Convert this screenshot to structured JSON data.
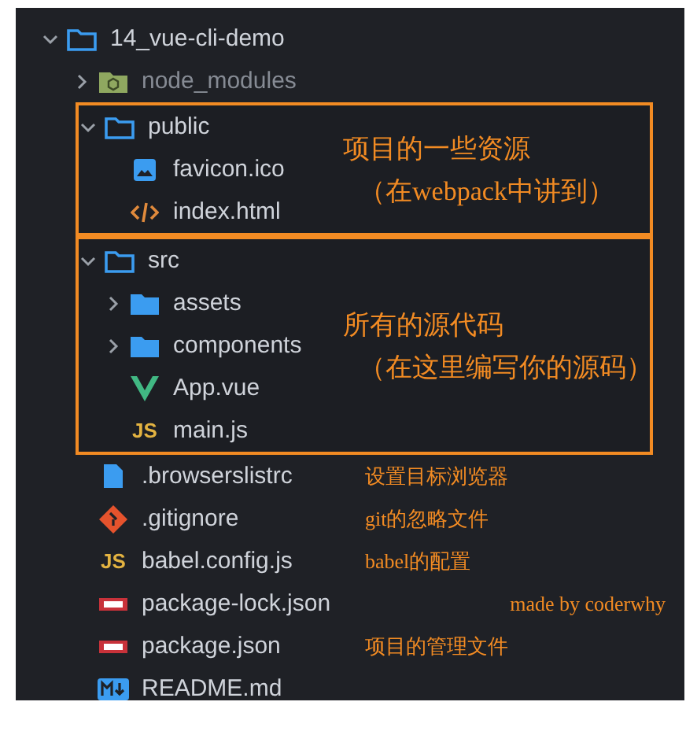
{
  "tree": {
    "name": "14_vue-cli-demo",
    "kind": "folder",
    "expanded": true,
    "children": [
      {
        "name": "node_modules",
        "kind": "node-folder",
        "expanded": false,
        "dimmed": true
      },
      {
        "name": "public",
        "kind": "folder",
        "expanded": true,
        "boxed": true,
        "note_lines": [
          "项目的一些资源",
          "（在webpack中讲到）"
        ],
        "children": [
          {
            "name": "favicon.ico",
            "kind": "image"
          },
          {
            "name": "index.html",
            "kind": "html"
          }
        ]
      },
      {
        "name": "src",
        "kind": "folder",
        "expanded": true,
        "boxed": true,
        "note_lines": [
          "所有的源代码",
          "（在这里编写你的源码）"
        ],
        "children": [
          {
            "name": "assets",
            "kind": "folder",
            "expanded": false
          },
          {
            "name": "components",
            "kind": "folder",
            "expanded": false
          },
          {
            "name": "App.vue",
            "kind": "vue"
          },
          {
            "name": "main.js",
            "kind": "js",
            "badge": "JS"
          }
        ]
      },
      {
        "name": ".browserslistrc",
        "kind": "file",
        "note": "设置目标浏览器"
      },
      {
        "name": ".gitignore",
        "kind": "git",
        "note": "git的忽略文件"
      },
      {
        "name": "babel.config.js",
        "kind": "js",
        "badge": "JS",
        "note": "babel的配置"
      },
      {
        "name": "package-lock.json",
        "kind": "npm",
        "credit": "made by coderwhy"
      },
      {
        "name": "package.json",
        "kind": "npm",
        "note": "项目的管理文件"
      },
      {
        "name": "README.md",
        "kind": "markdown"
      }
    ]
  }
}
